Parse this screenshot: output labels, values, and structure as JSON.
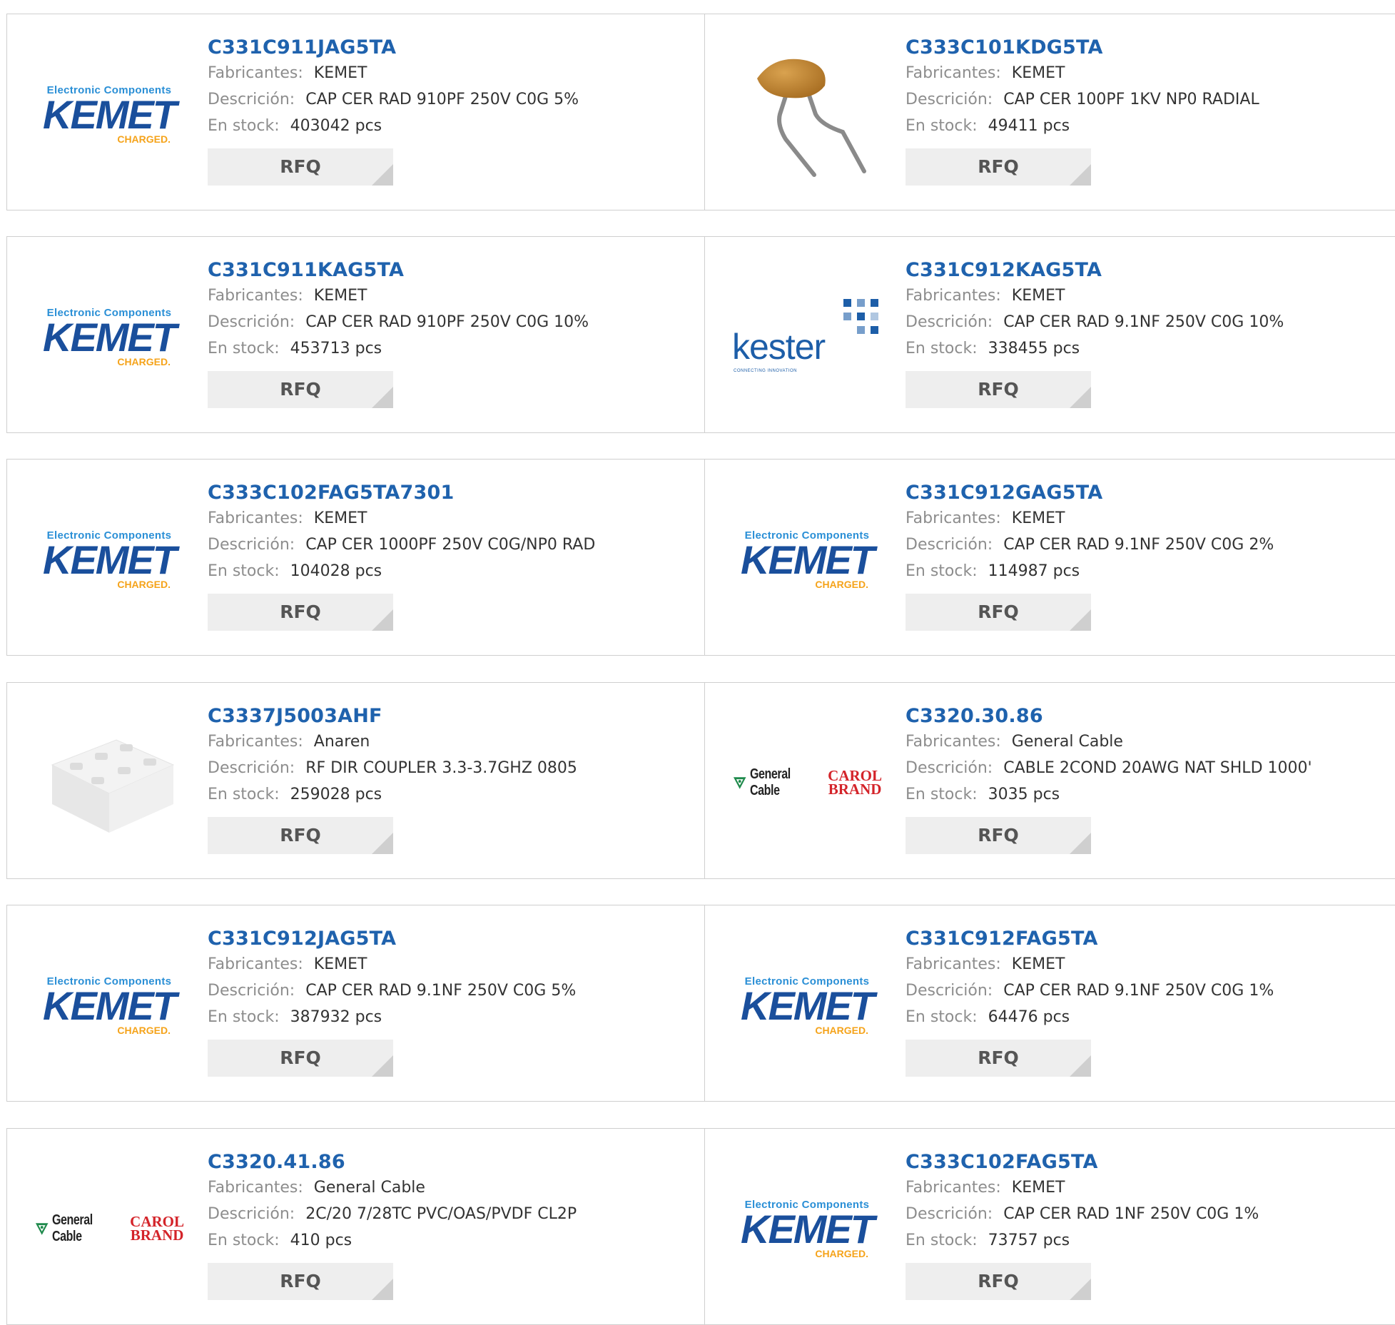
{
  "labels": {
    "manufacturer": "Fabricantes:",
    "description": "Descrición:",
    "stock": "En stock:",
    "rfq": "RFQ"
  },
  "brand_logos": {
    "kemet": {
      "top": "Electronic Components",
      "name": "KEMET",
      "tagline": "CHARGED."
    },
    "general_cable": {
      "name": "General Cable",
      "carol_1": "CAROL",
      "carol_2": "BRAND"
    },
    "kester": {
      "name": "kester",
      "tagline": "CONNECTING INNOVATION"
    }
  },
  "colors": {
    "title": "#1f62ad",
    "label": "#8d8d8d",
    "value": "#333333",
    "button_bg": "#eeeeee",
    "border": "#cfcfcf"
  },
  "products": [
    {
      "part": "C331C911JAG5TA",
      "manufacturer": "KEMET",
      "description": "CAP CER RAD 910PF 250V C0G 5%",
      "stock": "403042 pcs",
      "image": "kemet-logo"
    },
    {
      "part": "C333C101KDG5TA",
      "manufacturer": "KEMET",
      "description": "CAP CER 100PF 1KV NP0 RADIAL",
      "stock": "49411 pcs",
      "image": "ceramic-capacitor-photo"
    },
    {
      "part": "C331C911KAG5TA",
      "manufacturer": "KEMET",
      "description": "CAP CER RAD 910PF 250V C0G 10%",
      "stock": "453713 pcs",
      "image": "kemet-logo"
    },
    {
      "part": "C331C912KAG5TA",
      "manufacturer": "KEMET",
      "description": "CAP CER RAD 9.1NF 250V C0G 10%",
      "stock": "338455 pcs",
      "image": "kester-logo"
    },
    {
      "part": "C333C102FAG5TA7301",
      "manufacturer": "KEMET",
      "description": "CAP CER 1000PF 250V C0G/NP0 RAD",
      "stock": "104028 pcs",
      "image": "kemet-logo"
    },
    {
      "part": "C331C912GAG5TA",
      "manufacturer": "KEMET",
      "description": "CAP CER RAD 9.1NF 250V C0G 2%",
      "stock": "114987 pcs",
      "image": "kemet-logo"
    },
    {
      "part": "C3337J5003AHF",
      "manufacturer": "Anaren",
      "description": "RF DIR COUPLER 3.3-3.7GHZ 0805",
      "stock": "259028 pcs",
      "image": "rf-coupler-photo"
    },
    {
      "part": "C3320.30.86",
      "manufacturer": "General Cable",
      "description": "CABLE 2COND 20AWG NAT SHLD 1000'",
      "stock": "3035 pcs",
      "image": "general-cable-logo"
    },
    {
      "part": "C331C912JAG5TA",
      "manufacturer": "KEMET",
      "description": "CAP CER RAD 9.1NF 250V C0G 5%",
      "stock": "387932 pcs",
      "image": "kemet-logo"
    },
    {
      "part": "C331C912FAG5TA",
      "manufacturer": "KEMET",
      "description": "CAP CER RAD 9.1NF 250V C0G 1%",
      "stock": "64476 pcs",
      "image": "kemet-logo"
    },
    {
      "part": "C3320.41.86",
      "manufacturer": "General Cable",
      "description": "2C/20 7/28TC PVC/OAS/PVDF CL2P",
      "stock": "410 pcs",
      "image": "general-cable-logo"
    },
    {
      "part": "C333C102FAG5TA",
      "manufacturer": "KEMET",
      "description": "CAP CER RAD 1NF 250V C0G 1%",
      "stock": "73757 pcs",
      "image": "kemet-logo"
    }
  ]
}
